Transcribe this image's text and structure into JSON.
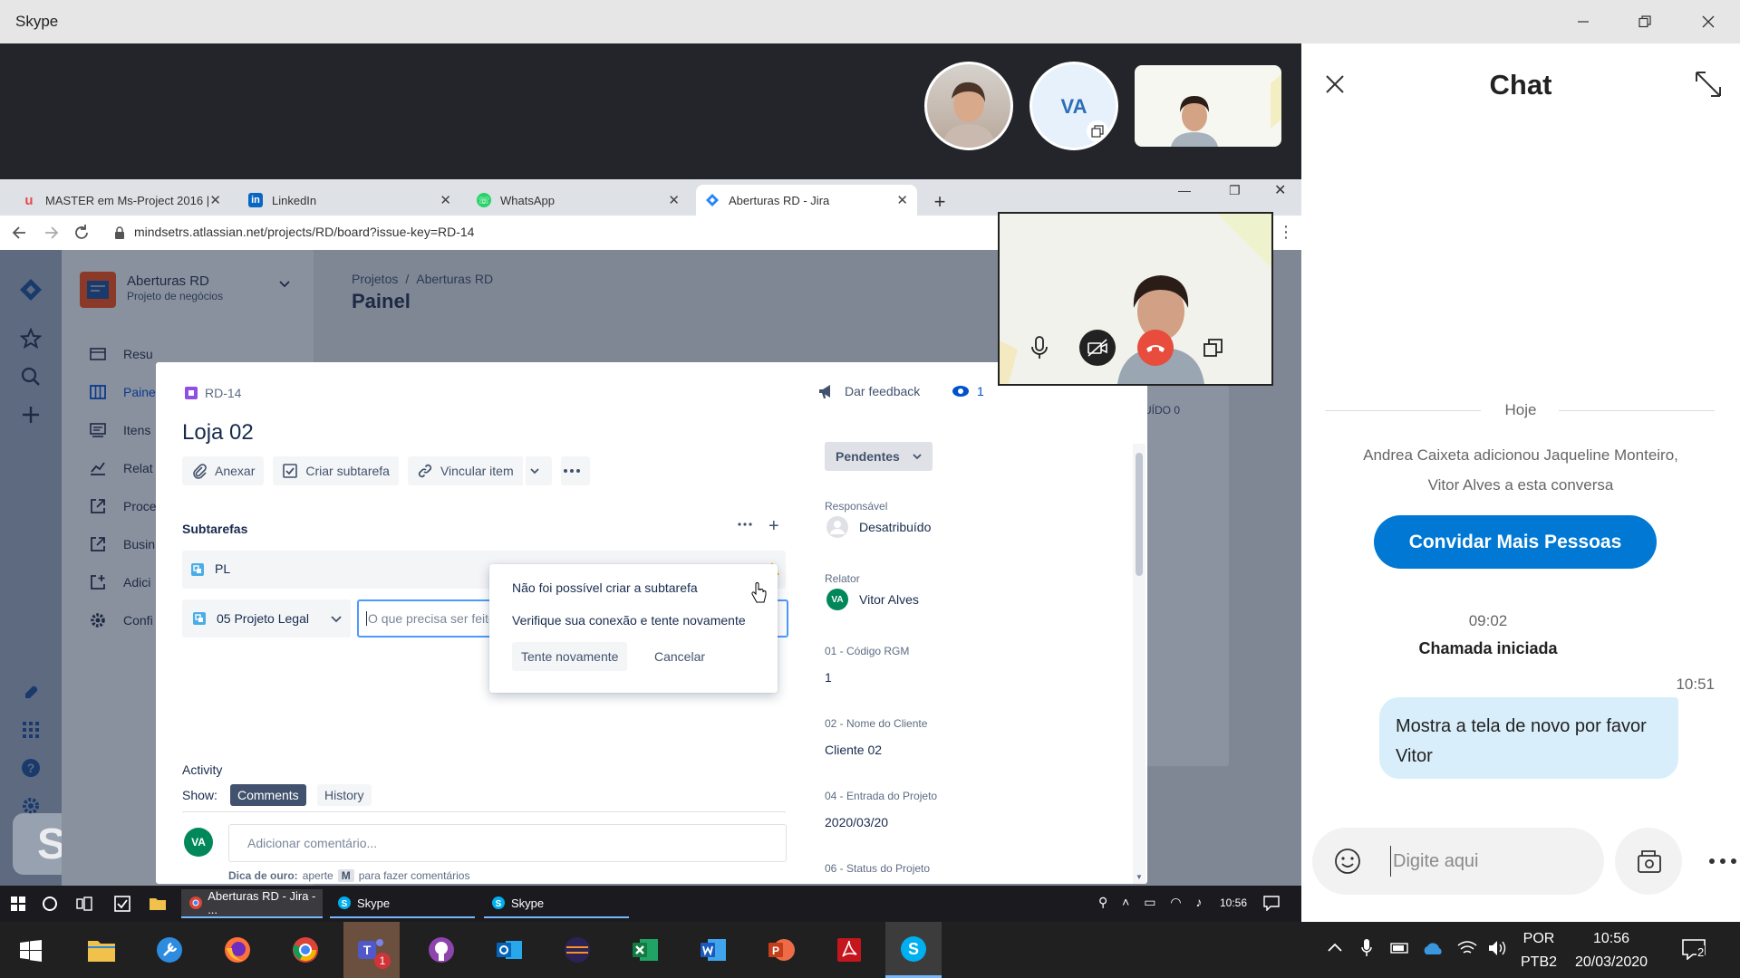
{
  "skype": {
    "title": "Skype",
    "participants": {
      "initials": "VA"
    }
  },
  "browser": {
    "tabs": [
      {
        "label": "MASTER em Ms-Project 2016 | U",
        "icon": "udemy-icon"
      },
      {
        "label": "LinkedIn",
        "icon": "linkedin-icon"
      },
      {
        "label": "WhatsApp",
        "icon": "whatsapp-icon"
      },
      {
        "label": "Aberturas RD - Jira",
        "icon": "jira-icon"
      }
    ],
    "url": "mindsetrs.atlassian.net/projects/RD/board?issue-key=RD-14"
  },
  "jira": {
    "project_name": "Aberturas RD",
    "project_type": "Projeto de negócios",
    "breadcrumb": [
      "Projetos",
      "/",
      "Aberturas RD"
    ],
    "page_title_partial": "Painel",
    "sidebar_items": [
      "Resu",
      "Paine",
      "Itens",
      "Relat",
      "Proce",
      "Busin",
      "Adici",
      "Confi"
    ],
    "board_column_partial": "UÍDO 0",
    "modal": {
      "issue_key": "RD-14",
      "feedback_label": "Dar feedback",
      "watchers": "1",
      "title": "Loja 02",
      "toolbar": {
        "attach": "Anexar",
        "create_subtask": "Criar subtarefa",
        "link_item": "Vincular item"
      },
      "subtasks_heading": "Subtarefas",
      "subtask_row": "PL",
      "subtask_type": "05 Projeto Legal",
      "subtask_placeholder": "O que precisa ser feito?",
      "activity": {
        "heading": "Activity",
        "show_label": "Show:",
        "tabs": [
          "Comments",
          "History"
        ],
        "avatar": "VA",
        "comment_placeholder": "Adicionar comentário...",
        "tip_bold": "Dica de ouro:",
        "tip_pre": "aperte",
        "tip_key": "M",
        "tip_post": "para fazer comentários"
      },
      "status": "Pendentes",
      "fields": {
        "assignee_label": "Responsável",
        "assignee_value": "Desatribuído",
        "reporter_label": "Relator",
        "reporter_initials": "VA",
        "reporter_value": "Vitor Alves",
        "rgm_label": "01 - Código RGM",
        "rgm_value": "1",
        "client_label": "02 - Nome do Cliente",
        "client_value": "Cliente 02",
        "entry_label": "04 - Entrada do Projeto",
        "entry_value": "2020/03/20",
        "status_label": "06 - Status do Projeto"
      }
    },
    "popup": {
      "title": "Não foi possível criar a subtarefa",
      "message": "Verifique sua conexão e tente novamente",
      "retry": "Tente novamente",
      "cancel": "Cancelar"
    }
  },
  "chat": {
    "title": "Chat",
    "date_separator": "Hoje",
    "system_message": "Andrea Caixeta adicionou Jaqueline Monteiro, Vitor Alves a esta conversa",
    "invite_button": "Convidar Mais Pessoas",
    "call_time": "09:02",
    "call_text": "Chamada iniciada",
    "msg_time": "10:51",
    "message": "Mostra a tela de novo por favor Vitor",
    "input_placeholder": "Digite aqui"
  },
  "inner_taskbar": {
    "items": [
      "Aberturas RD - Jira - ...",
      "Skype",
      "Skype"
    ],
    "time": "10:56"
  },
  "outer_taskbar": {
    "teams_badge": "1",
    "lang_top": "POR",
    "lang_bottom": "PTB2",
    "time": "10:56",
    "date": "20/03/2020",
    "notifications": "2"
  },
  "colors": {
    "skype_blue": "#0078d4",
    "chat_bubble": "#d8eefa",
    "jira_blue": "#0052cc",
    "end_call_red": "#e74c3c"
  }
}
